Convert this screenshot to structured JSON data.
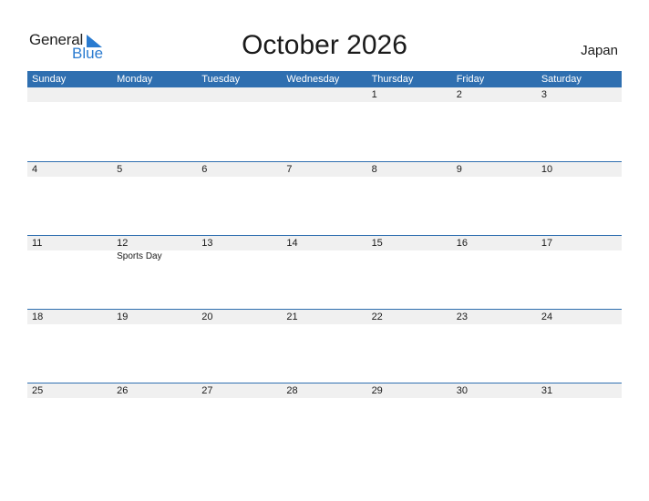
{
  "logo": {
    "line1": "General",
    "line2": "Blue"
  },
  "title": "October 2026",
  "country": "Japan",
  "colors": {
    "header_bg": "#2f6fb0",
    "band_bg": "#f0f0f0",
    "logo_blue": "#2a7bd0"
  },
  "weekdays": [
    "Sunday",
    "Monday",
    "Tuesday",
    "Wednesday",
    "Thursday",
    "Friday",
    "Saturday"
  ],
  "weeks": [
    {
      "days": [
        "",
        "",
        "",
        "",
        "1",
        "2",
        "3"
      ],
      "events": [
        "",
        "",
        "",
        "",
        "",
        "",
        ""
      ]
    },
    {
      "days": [
        "4",
        "5",
        "6",
        "7",
        "8",
        "9",
        "10"
      ],
      "events": [
        "",
        "",
        "",
        "",
        "",
        "",
        ""
      ]
    },
    {
      "days": [
        "11",
        "12",
        "13",
        "14",
        "15",
        "16",
        "17"
      ],
      "events": [
        "",
        "Sports Day",
        "",
        "",
        "",
        "",
        ""
      ]
    },
    {
      "days": [
        "18",
        "19",
        "20",
        "21",
        "22",
        "23",
        "24"
      ],
      "events": [
        "",
        "",
        "",
        "",
        "",
        "",
        ""
      ]
    },
    {
      "days": [
        "25",
        "26",
        "27",
        "28",
        "29",
        "30",
        "31"
      ],
      "events": [
        "",
        "",
        "",
        "",
        "",
        "",
        ""
      ]
    }
  ]
}
